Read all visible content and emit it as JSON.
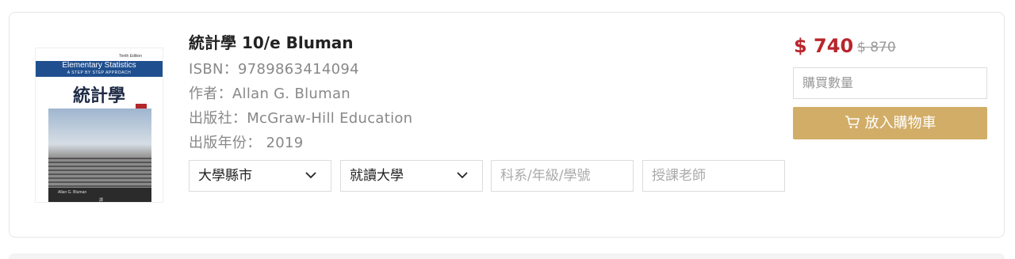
{
  "product": {
    "title": "統計學 10/e Bluman",
    "isbn": "ISBN：9789863414094",
    "author": "作者：Allan G. Bluman",
    "publisher": "出版社：McGraw-Hill Education",
    "year": "出版年份： 2019"
  },
  "cover": {
    "edition": "Tenth Edition",
    "title_en": "Elementary Statistics",
    "subtitle_en": "A STEP BY STEP APPROACH",
    "title_cn": "統計學",
    "author_label": "Allan G. Bluman",
    "translator_label": "譯"
  },
  "filters": {
    "city_select": "大學縣市",
    "university_select": "就讀大學",
    "dept_placeholder": "科系/年級/學號",
    "teacher_placeholder": "授課老師"
  },
  "pricing": {
    "price": "$ 740",
    "original_price": "$ 870"
  },
  "actions": {
    "quantity_placeholder": "購買數量",
    "add_to_cart_label": "放入購物車"
  },
  "colors": {
    "price_red": "#b8262c",
    "cart_button": "#d2ad67"
  }
}
